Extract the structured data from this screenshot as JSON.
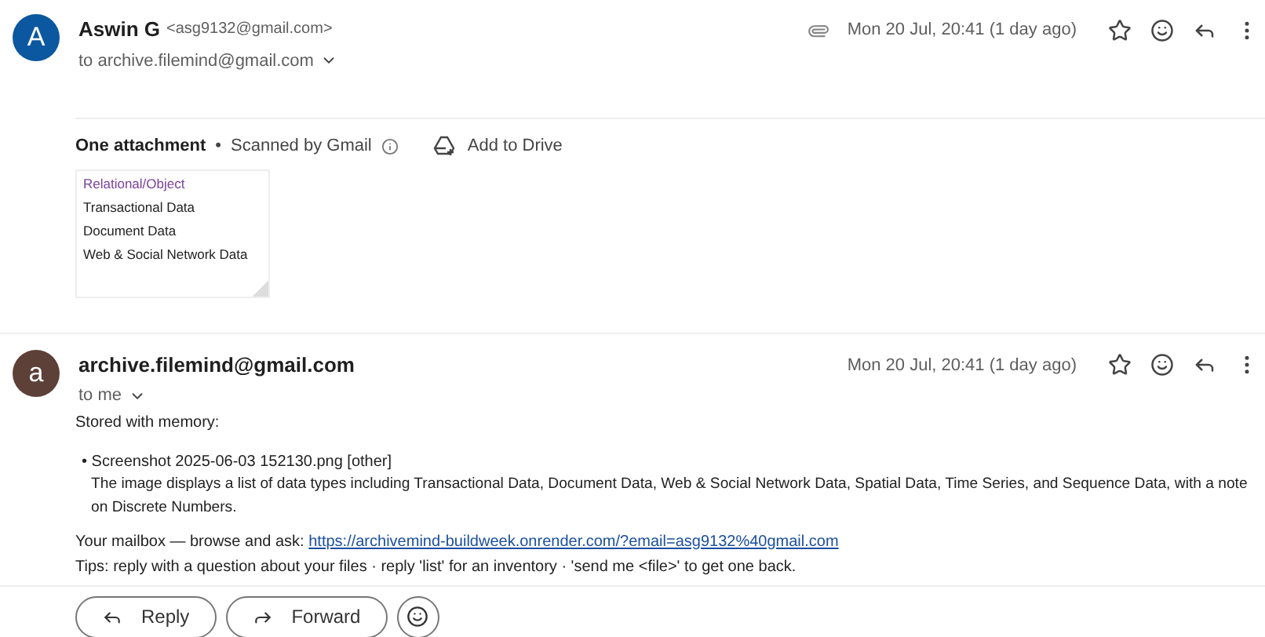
{
  "messages": [
    {
      "avatar_letter": "A",
      "color": "#0b57a0",
      "sender": "Aswin G",
      "sender_email": "<asg9132@gmail.com>",
      "recipient": "to archive.filemind@gmail.com",
      "has_attachment": true,
      "date": "Mon 20 Jul, 20:41 (1 day ago)"
    },
    {
      "avatar_letter": "a",
      "color": "#5d4037",
      "sender": "archive.filemind@gmail.com",
      "recipient": "to me",
      "date": "Mon 20 Jul, 20:41 (1 day ago)"
    }
  ],
  "attachments": {
    "title": "One attachment",
    "separator": "•",
    "scan_note": "Scanned by Gmail",
    "add_to_drive": "Add to Drive",
    "thumbnail_lines": [
      "Relational/Object",
      "Transactional Data",
      "Document Data",
      "Web & Social Network Data"
    ]
  },
  "body": {
    "intro": "Stored with memory:",
    "bullet": "• Screenshot 2025-06-03 152130.png [other]",
    "description": "The image displays a list of data types including Transactional Data, Document Data, Web & Social Network Data, Spatial Data, Time Series, and Sequence Data, with a note on Discrete Numbers.",
    "mailbox_label": "Your mailbox — browse and ask:",
    "mailbox_link": "https://archivemind-buildweek.onrender.com/?email=asg9132%40gmail.com",
    "tips": "Tips: reply with a question about your files · reply 'list' for an inventory · 'send me <file>' to get one back."
  },
  "actions": [
    "Reply",
    "Forward"
  ]
}
